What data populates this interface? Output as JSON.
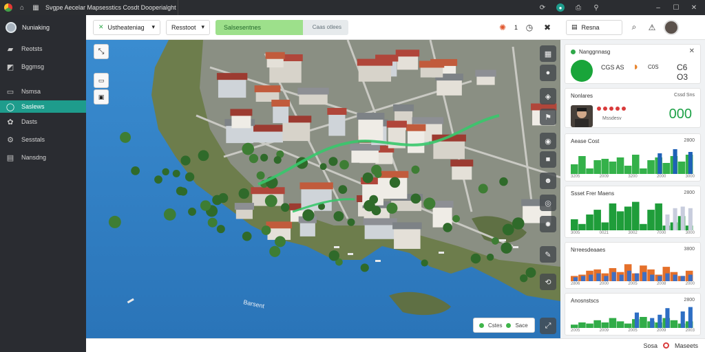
{
  "titlebar": {
    "app_icon": "app-logo-icon",
    "title": "Svgpe Aecelar Mapsesstics Cosdt Dooperialght"
  },
  "sidebar": {
    "header": "Nuniaking",
    "items": [
      {
        "label": "Reotsts",
        "icon": "folder-icon",
        "active": false
      },
      {
        "label": "Bggmsg",
        "icon": "archive-icon",
        "active": false
      },
      {
        "label": "Nsmsa",
        "icon": "tray-icon",
        "active": false
      },
      {
        "label": "Saslews",
        "icon": "chat-icon",
        "active": true
      },
      {
        "label": "Dasts",
        "icon": "gear-icon",
        "active": false
      },
      {
        "label": "Sesstals",
        "icon": "settings-icon",
        "active": false
      },
      {
        "label": "Nansdng",
        "icon": "inbox-icon",
        "active": false
      }
    ]
  },
  "toolbar": {
    "select1": "Ustheateniag",
    "select2": "Resstoot",
    "progress_label": "Salsesentnes",
    "progress_sub": "Caas otlees",
    "progress_fraction": 0.66,
    "count": "1"
  },
  "map": {
    "legend_a": "Cstes",
    "legend_b": "Sace",
    "water_label": "Barsent"
  },
  "panel": {
    "select": "Resna",
    "card1": {
      "title": "Nanggnnasg",
      "v1": "CGS AS",
      "v2": "C0S",
      "v3": "C6 O3"
    },
    "card2": {
      "title": "Nonlares",
      "value": "000",
      "sub": "Mssdesv",
      "sub2": "Cssd Sns",
      "dots": [
        "#d93b3b",
        "#d93b3b",
        "#d93b3b",
        "#d93b3b",
        "#d93b3b"
      ]
    },
    "charts": [
      {
        "title": "Aease Cost",
        "value": "2800",
        "ticks": [
          "3205",
          "2009",
          "3200",
          "2000",
          "3000"
        ],
        "series": [
          {
            "color": "#34b14a",
            "values": [
              14,
              26,
              8,
              20,
              22,
              18,
              24,
              12,
              28,
              8,
              20,
              24,
              16,
              26,
              18,
              28
            ]
          },
          {
            "color": "#1f62b7",
            "values": [
              0,
              0,
              0,
              0,
              0,
              0,
              0,
              0,
              0,
              0,
              0,
              30,
              0,
              36,
              0,
              32
            ]
          }
        ]
      },
      {
        "title": "Ssset Frer Maens",
        "value": "2800",
        "ticks": [
          "3005",
          "0021",
          "3002",
          "7000",
          "3000"
        ],
        "series": [
          {
            "color": "#1f9d3a",
            "values": [
              14,
              8,
              20,
              26,
              10,
              34,
              24,
              30,
              36,
              8,
              26,
              34,
              6,
              10,
              18,
              6
            ]
          },
          {
            "color": "#c8cddd",
            "values": [
              0,
              0,
              0,
              0,
              0,
              0,
              0,
              0,
              0,
              0,
              0,
              0,
              20,
              28,
              30,
              28
            ]
          }
        ]
      },
      {
        "title": "Nrreesdeaaes",
        "value": "3800",
        "ticks": [
          "2806",
          "2000",
          "2005",
          "2008",
          "2000"
        ],
        "series": [
          {
            "color": "#e5702a",
            "values": [
              8,
              10,
              16,
              18,
              12,
              20,
              14,
              26,
              12,
              24,
              18,
              10,
              22,
              14,
              8,
              16
            ]
          },
          {
            "color": "#3f6fc2",
            "values": [
              6,
              8,
              10,
              12,
              8,
              14,
              10,
              16,
              12,
              14,
              10,
              8,
              12,
              10,
              8,
              10
            ]
          }
        ]
      },
      {
        "title": "Anosnstscs",
        "value": "2800",
        "ticks": [
          "2005",
          "2009",
          "2005",
          "2009",
          "2003"
        ],
        "series": [
          {
            "color": "#31ac48",
            "values": [
              6,
              10,
              8,
              14,
              10,
              18,
              12,
              8,
              16,
              20,
              12,
              10,
              18,
              14,
              8,
              12
            ]
          },
          {
            "color": "#2d6ec4",
            "values": [
              0,
              0,
              0,
              0,
              0,
              0,
              0,
              0,
              28,
              0,
              18,
              24,
              36,
              0,
              30,
              38
            ]
          }
        ]
      }
    ]
  },
  "statusbar": {
    "left": "Sosa",
    "right": "Maseets"
  },
  "colors": {
    "accent": "#1e9c8c",
    "water": "#2f7ec1",
    "sidebar": "#2a2c31",
    "route": "#38c56b"
  }
}
